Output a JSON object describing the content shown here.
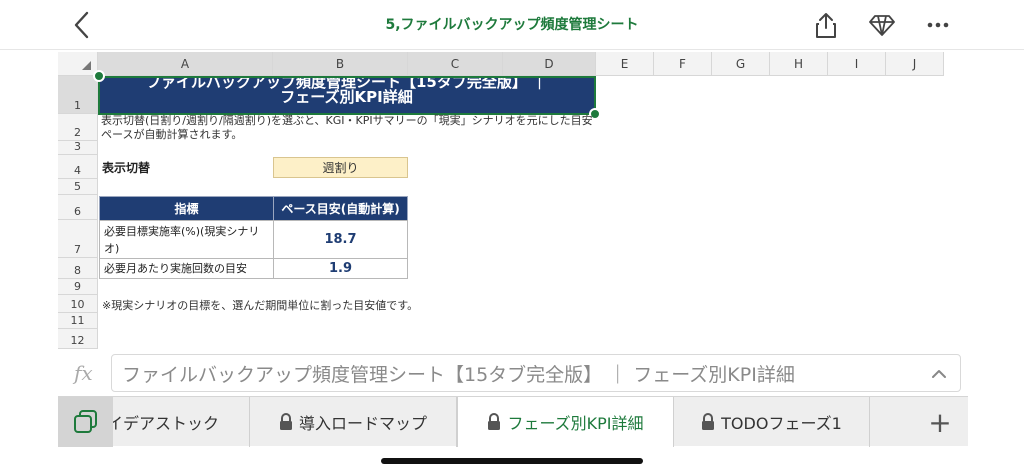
{
  "header": {
    "title": "5,ファイルバックアップ頻度管理シート"
  },
  "grid": {
    "columns": [
      "A",
      "B",
      "C",
      "D",
      "E",
      "F",
      "G",
      "H",
      "I",
      "J"
    ],
    "rows": [
      "1",
      "2",
      "3",
      "4",
      "5",
      "6",
      "7",
      "8",
      "9",
      "10",
      "11",
      "12"
    ]
  },
  "sheet": {
    "title_line1": "ファイルバックアップ頻度管理シート【15タブ完全版】 ｜",
    "title_line2": "フェーズ別KPI詳細",
    "description": "表示切替(日割り/週割り/隔週割り)を選ぶと、KGI・KPIサマリーの「現実」シナリオを元にした目安ペースが自動計算されます。",
    "toggle_label": "表示切替",
    "toggle_value": "週割り",
    "table": {
      "headers": [
        "指標",
        "ペース目安(自動計算)"
      ],
      "rows": [
        {
          "label": "必要目標実施率(%)(現実シナリオ)",
          "value": "18.7"
        },
        {
          "label": "必要月あたり実施回数の目安",
          "value": "1.9"
        }
      ]
    },
    "note": "※現実シナリオの目標を、選んだ期間単位に割った目安値です。"
  },
  "formula_bar": {
    "fx_label": "fx",
    "content": "ファイルバックアップ頻度管理シート【15タブ完全版】 ｜ フェーズ別KPI詳細"
  },
  "tabs": {
    "items": [
      {
        "label": "イデアストック"
      },
      {
        "label": "導入ロードマップ"
      },
      {
        "label": "フェーズ別KPI詳細"
      },
      {
        "label": "TODOフェーズ1"
      }
    ],
    "add_label": "+"
  },
  "colors": {
    "accent": "#1e7a3c",
    "header_fill": "#1f3d73",
    "dropdown_fill": "#fdf0c8"
  }
}
